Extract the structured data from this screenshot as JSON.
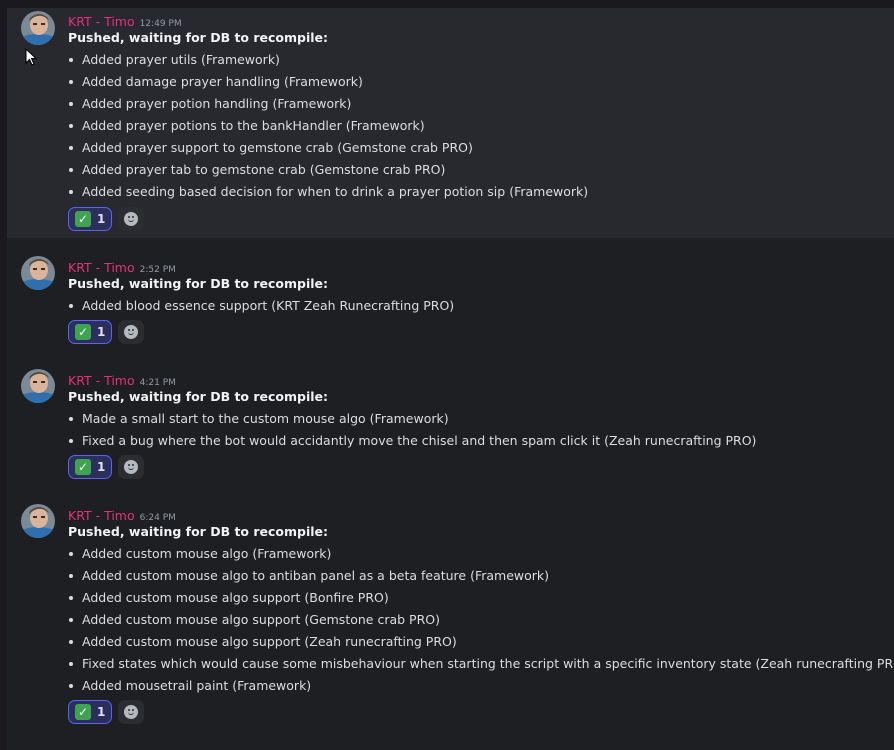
{
  "messages": [
    {
      "author": "KRT - Timo",
      "time": "12:49 PM",
      "headline": "Pushed, waiting for DB to recompile:",
      "items": [
        "Added prayer utils (Framework)",
        "Added damage prayer handling (Framework)",
        "Added prayer potion handling (Framework)",
        "Added prayer potions to the bankHandler (Framework)",
        "Added prayer support to gemstone crab (Gemstone crab PRO)",
        "Added prayer tab to gemstone crab (Gemstone crab PRO)",
        "Added seeding based decision for when to drink a prayer potion sip (Framework)"
      ],
      "reaction": {
        "emoji": "check-mark-button",
        "count": "1"
      }
    },
    {
      "author": "KRT - Timo",
      "time": "2:52 PM",
      "headline": "Pushed, waiting for DB to recompile:",
      "items": [
        "Added blood essence support (KRT Zeah Runecrafting PRO)"
      ],
      "reaction": {
        "emoji": "check-mark-button",
        "count": "1"
      }
    },
    {
      "author": "KRT - Timo",
      "time": "4:21 PM",
      "headline": "Pushed, waiting for DB to recompile:",
      "items": [
        "Made a small start to the custom mouse algo (Framework)",
        "Fixed a bug where the bot would accidantly move the chisel and then spam click it (Zeah runecrafting PRO)"
      ],
      "reaction": {
        "emoji": "check-mark-button",
        "count": "1"
      }
    },
    {
      "author": "KRT - Timo",
      "time": "6:24 PM",
      "headline": "Pushed, waiting for DB to recompile:",
      "items": [
        "Added custom mouse algo (Framework)",
        "Added custom mouse algo to antiban panel as a beta feature (Framework)",
        "Added custom mouse algo support (Bonfire PRO)",
        "Added custom mouse algo support (Gemstone crab PRO)",
        "Added custom mouse algo support (Zeah runecrafting PRO)",
        "Fixed states which would cause some misbehaviour when starting the script with a specific inventory state (Zeah runecrafting PRO)",
        "Added mousetrail paint (Framework)"
      ],
      "reaction": {
        "emoji": "check-mark-button",
        "count": "1"
      }
    }
  ],
  "icons": {
    "check": "✓",
    "add_reaction": "smiley-plus-icon"
  },
  "colors": {
    "author": "#e5307b",
    "reaction_border": "#5865f2",
    "check_green": "#40a351",
    "background": "#1e1f22",
    "highlight": "#28292e"
  }
}
